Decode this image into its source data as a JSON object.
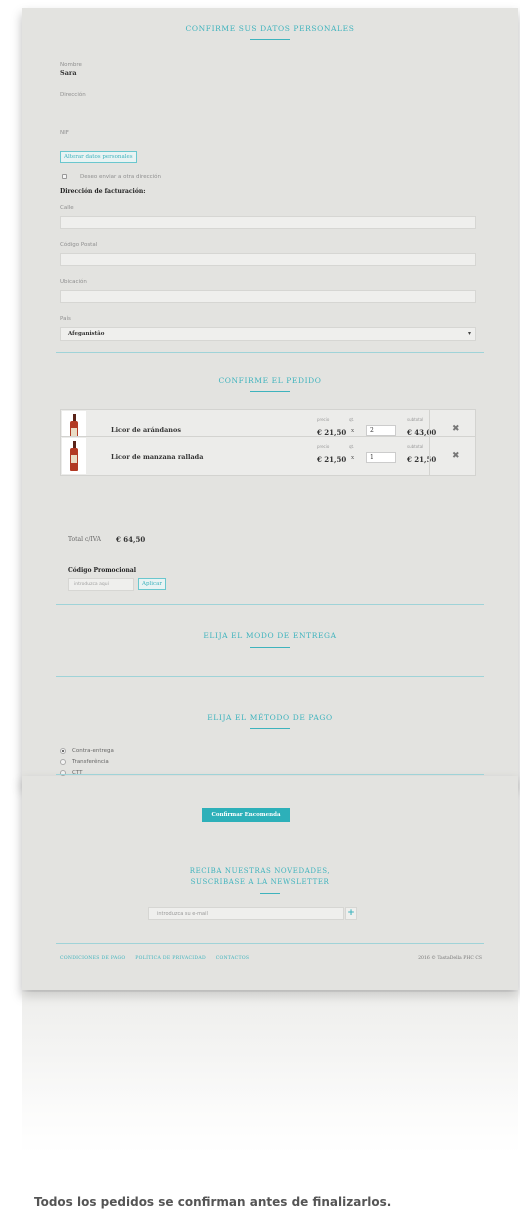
{
  "personal": {
    "title": "CONFIRME SUS DATOS PERSONALES",
    "name_label": "Nombre",
    "name_value": "Sara",
    "address_label": "Dirección",
    "nif_label": "NIF",
    "change_button": "Alterar datos personales",
    "ship_checkbox_label": "Deseo enviar a otra dirección",
    "billing_heading": "Dirección de facturación:",
    "street_label": "Calle",
    "postal_label": "Código Postal",
    "location_label": "Ubicación",
    "country_label": "País",
    "country_value": "Afeganistão"
  },
  "order": {
    "title": "CONFIRME EL PEDIDO",
    "headers": {
      "price": "precio",
      "qty": "qt.",
      "subtotal": "subtotal"
    },
    "items": [
      {
        "name": "Licor de arándanos",
        "price": "€ 21,50",
        "qty": "2",
        "subtotal": "€ 43,00"
      },
      {
        "name": "Licor de manzana rallada",
        "price": "€ 21,50",
        "qty": "1",
        "subtotal": "€ 21,50"
      }
    ],
    "total_label": "Total c/IVA",
    "total_value": "€ 64,50",
    "promo_label": "Código Promocional",
    "promo_placeholder": "introduzca aquí",
    "apply_button": "Aplicar"
  },
  "delivery": {
    "title": "ELIJA EL MODO DE ENTREGA"
  },
  "payment": {
    "title": "ELIJA EL MÉTODO DE PAGO",
    "options": [
      "Contra-entrega",
      "Transferência",
      "CTT"
    ],
    "selected": "Contra-entrega"
  },
  "confirm_button": "Confirmar Encomenda",
  "newsletter": {
    "title_line1": "RECIBA NUESTRAS NOVEDADES,",
    "title_line2": "SUSCRIBASE A LA NEWSLETTER",
    "placeholder": "introduzca su e-mail",
    "plus": "+"
  },
  "footer": {
    "links": [
      "CONDICIONES DE PAGO",
      "POLÍTICA DE PRIVACIDAD",
      "CONTACTOS"
    ],
    "copyright": "2016 © TastaDella PHC CS"
  },
  "caption": "Todos los pedidos se confirman antes de finalizarlos.",
  "colors": {
    "accent": "#3eb3bd",
    "sheet": "#e3e3e0",
    "button": "#2db0b9"
  }
}
